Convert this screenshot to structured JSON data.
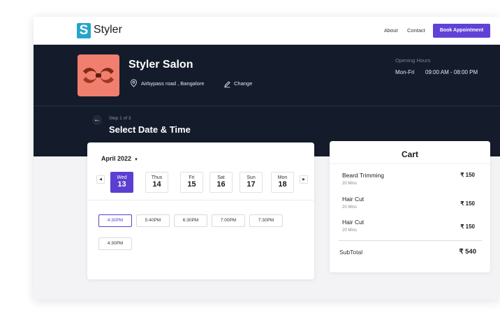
{
  "brand": {
    "logo_letter": "S",
    "name": "Styler",
    "color": "#25a6c8"
  },
  "nav": {
    "about": "About",
    "contact": "Contact",
    "book_button": "Book Appointment",
    "accent": "#6042d6"
  },
  "salon": {
    "name": "Styler Salon",
    "address": "Airbypass road , Bangalore",
    "change": "Change",
    "hours_label": "Opening Hours",
    "hours_days": "Mon-Fri",
    "hours_time": "09:00 AM - 08:00 PM"
  },
  "step": {
    "label": "Step 1 of 3",
    "title": "Select Date & Time"
  },
  "calendar": {
    "month": "April 2022",
    "days": [
      {
        "name": "Wed",
        "num": "13",
        "selected": true
      },
      {
        "name": "Thus",
        "num": "14",
        "selected": false
      },
      {
        "name": "Fri",
        "num": "15",
        "selected": false
      },
      {
        "name": "Sat",
        "num": "16",
        "selected": false
      },
      {
        "name": "Sun",
        "num": "17",
        "selected": false
      },
      {
        "name": "Mon",
        "num": "18",
        "selected": false
      }
    ],
    "slots": [
      {
        "label": "4:30PM",
        "selected": true
      },
      {
        "label": "5:40PM",
        "selected": false
      },
      {
        "label": "6:30PM",
        "selected": false
      },
      {
        "label": "7:00PM",
        "selected": false
      },
      {
        "label": "7:30PM",
        "selected": false
      },
      {
        "label": "4:30PM",
        "selected": false
      }
    ]
  },
  "cart": {
    "title": "Cart",
    "items": [
      {
        "name": "Beard Trimming",
        "duration": "20 Mins",
        "price": "₹ 150"
      },
      {
        "name": "Hair Cut",
        "duration": "20 Mins",
        "price": "₹ 150"
      },
      {
        "name": "Hair Cut",
        "duration": "20 Mins",
        "price": "₹ 150"
      }
    ],
    "subtotal_label": "SubTotal",
    "subtotal_value": "₹ 540"
  },
  "icons": {
    "location": "location-pin-icon",
    "edit": "pencil-icon",
    "back": "arrow-left-icon",
    "caret": "chevron-down-icon",
    "prev": "chevron-left-icon",
    "next": "chevron-right-icon"
  }
}
